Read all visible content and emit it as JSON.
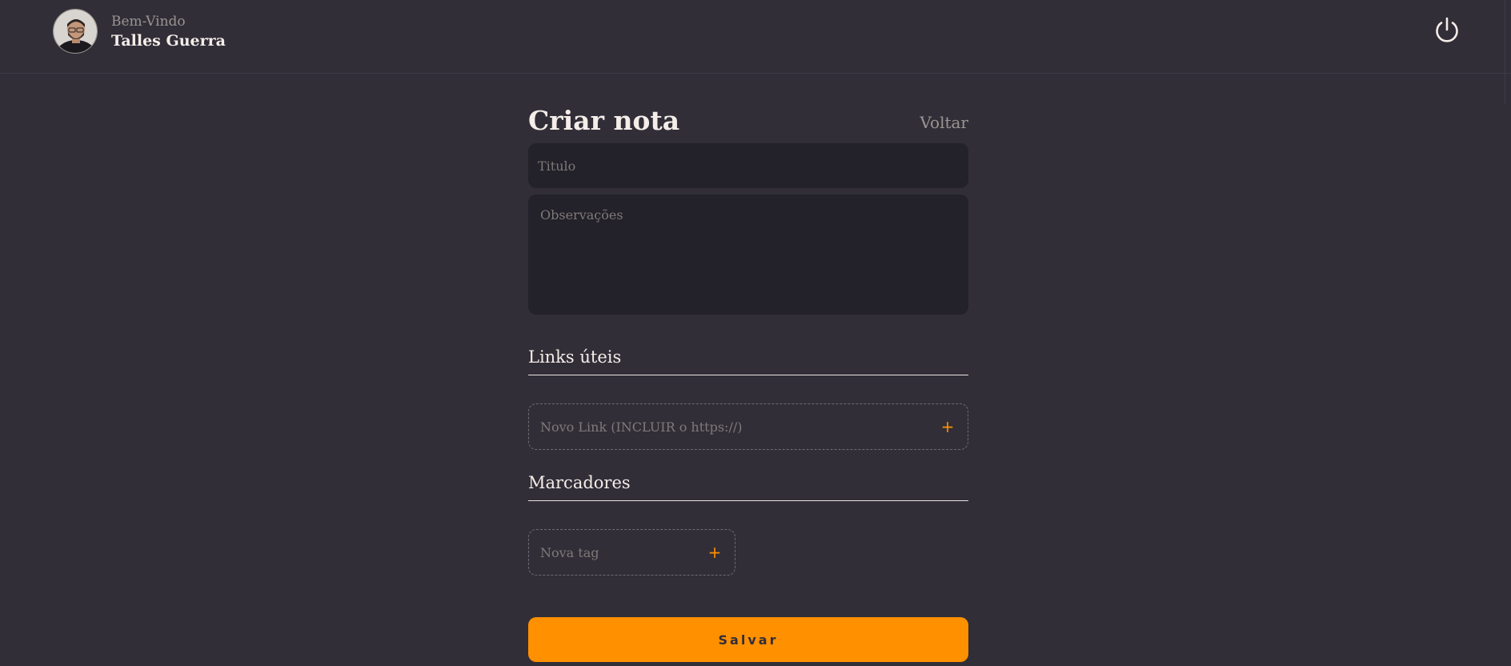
{
  "header": {
    "welcome": "Bem-Vindo",
    "user_name": "Talles Guerra",
    "avatar_icon": "user-avatar",
    "signout_icon": "power-icon"
  },
  "form": {
    "title": "Criar nota",
    "back_label": "Voltar",
    "title_placeholder": "Titulo",
    "notes_placeholder": "Observações",
    "links_section": "Links úteis",
    "link_placeholder": "Novo Link (INCLUIR o https://)",
    "tags_section": "Marcadores",
    "tag_placeholder": "Nova tag",
    "add_symbol": "+",
    "save_label": "Salvar"
  },
  "colors": {
    "background": "#312e38",
    "input_background": "#232129",
    "accent": "#ff9000",
    "text": "#f4ede8",
    "muted": "#999591"
  }
}
